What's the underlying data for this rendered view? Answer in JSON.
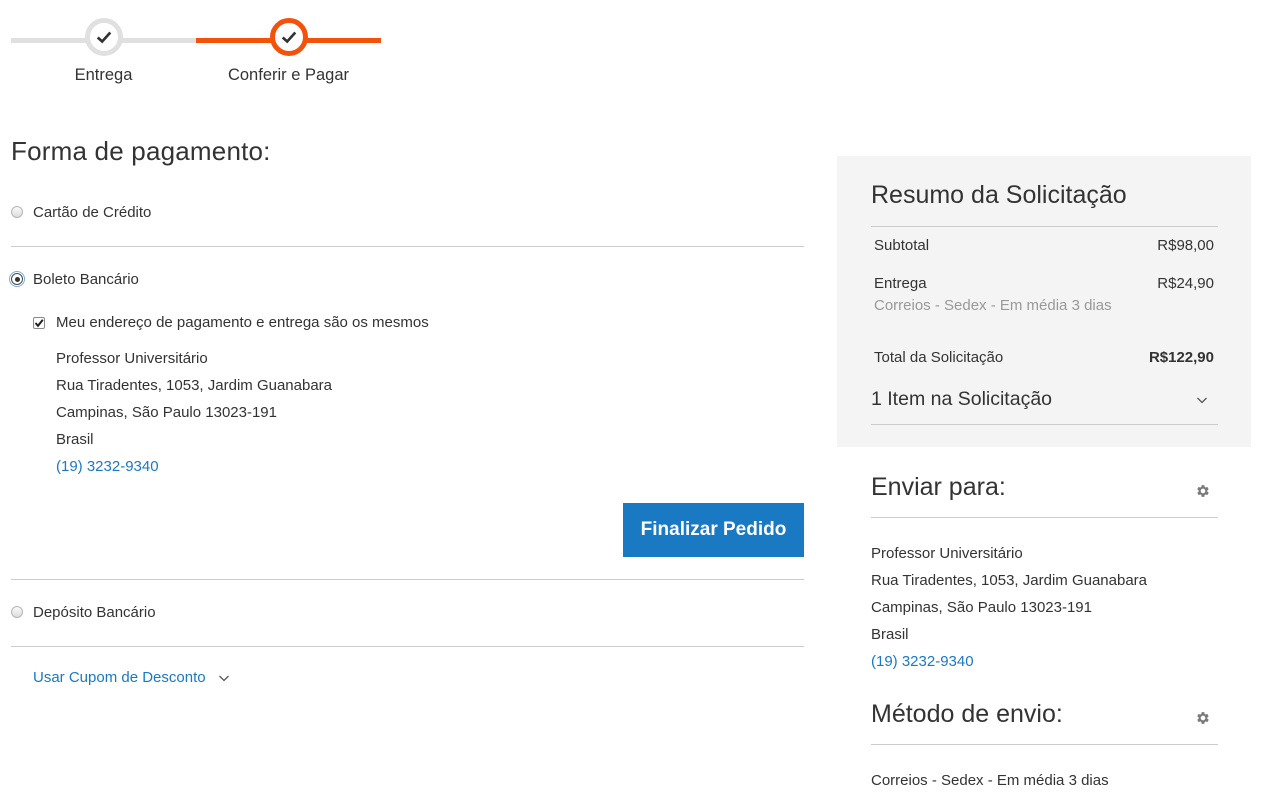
{
  "progress": {
    "steps": [
      {
        "label": "Entrega",
        "state": "done"
      },
      {
        "label": "Conferir e Pagar",
        "state": "current"
      }
    ]
  },
  "payment": {
    "title": "Forma de pagamento:",
    "methods": [
      {
        "label": "Cartão de Crédito",
        "selected": false
      },
      {
        "label": "Boleto Bancário",
        "selected": true
      },
      {
        "label": "Depósito Bancário",
        "selected": false
      }
    ],
    "same_address_label": "Meu endereço de pagamento e entrega são os mesmos",
    "address": {
      "name": "Professor Universitário",
      "street": "Rua Tiradentes, 1053, Jardim Guanabara",
      "city": "Campinas, São Paulo 13023-191",
      "country": "Brasil",
      "phone": "(19) 3232-9340"
    },
    "submit_label": "Finalizar Pedido",
    "coupon_label": "Usar Cupom de Desconto"
  },
  "summary": {
    "title": "Resumo da Solicitação",
    "subtotal_label": "Subtotal",
    "subtotal_value": "R$98,00",
    "shipping_label": "Entrega",
    "shipping_value": "R$24,90",
    "shipping_method": "Correios - Sedex - Em média 3 dias",
    "total_label": "Total da Solicitação",
    "total_value": "R$122,90",
    "items_label": "1 Item na Solicitação"
  },
  "ship_to": {
    "title": "Enviar para:",
    "name": "Professor Universitário",
    "street": "Rua Tiradentes, 1053, Jardim Guanabara",
    "city": "Campinas, São Paulo 13023-191",
    "country": "Brasil",
    "phone": "(19) 3232-9340"
  },
  "ship_method": {
    "title": "Método de envio:",
    "value": "Correios - Sedex - Em média 3 dias"
  },
  "colors": {
    "accent": "#f2520a",
    "primary": "#1979c3",
    "summary_bg": "#f4f4f4"
  }
}
